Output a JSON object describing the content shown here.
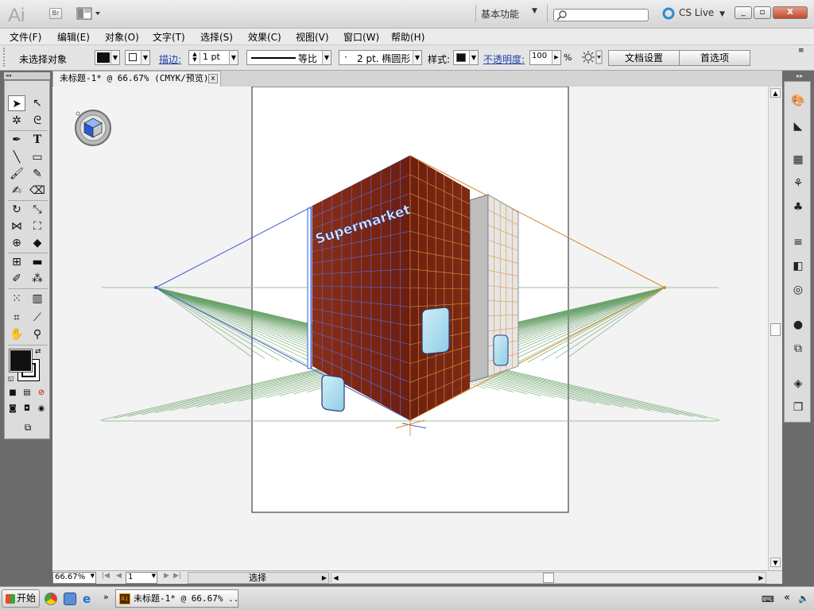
{
  "app": {
    "logo": "Ai",
    "bridge": "Br",
    "workspace": "基本功能",
    "cs_live": "CS Live",
    "win_min": "_",
    "win_restore": "▫",
    "win_close": "X"
  },
  "menu": [
    "文件(F)",
    "编辑(E)",
    "对象(O)",
    "文字(T)",
    "选择(S)",
    "效果(C)",
    "视图(V)",
    "窗口(W)",
    "帮助(H)"
  ],
  "control": {
    "selection_status": "未选择对象",
    "stroke_label": "描边:",
    "stroke_weight": "1 pt",
    "stroke_profile": "等比",
    "brush": "2 pt. 椭圆形",
    "brush_prefix": "·",
    "style_label": "样式:",
    "opacity_label": "不透明度:",
    "opacity_value": "100",
    "opacity_unit": "%",
    "doc_setup": "文档设置",
    "preferences": "首选项"
  },
  "tab": {
    "title": "未标题-1* @ 66.67% (CMYK/预览)",
    "close": "x"
  },
  "artwork": {
    "sign": "Supermarket"
  },
  "status": {
    "zoom": "66.67%",
    "artboard": "1",
    "mode": "选择"
  },
  "taskbar": {
    "start": "开始",
    "task": "未标题-1* @ 66.67% ..."
  },
  "colors": {
    "building": "#7a2512",
    "grid_blue": "#3a5fd0",
    "grid_orange": "#d88a28",
    "grid_green": "#5a9a5a"
  }
}
